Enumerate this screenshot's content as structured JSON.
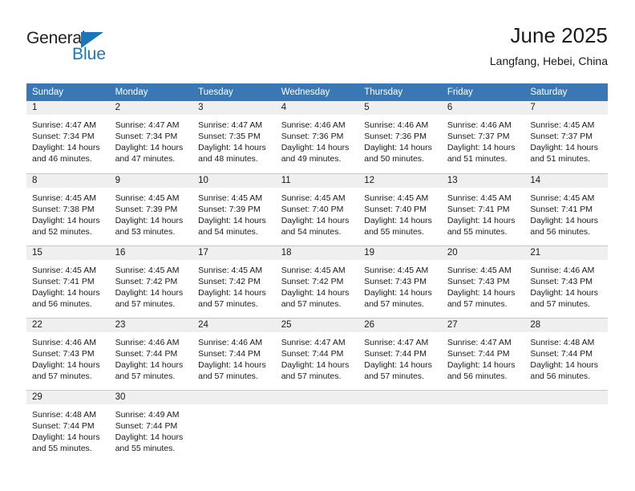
{
  "branding": {
    "logo_word_1": "General",
    "logo_word_2": "Blue",
    "triangle_color": "#1b75bb"
  },
  "header": {
    "title": "June 2025",
    "subtitle": "Langfang, Hebei, China",
    "header_bg_color": "#3a78b5",
    "daynum_band_color": "#efefef"
  },
  "weekday_headers": [
    "Sunday",
    "Monday",
    "Tuesday",
    "Wednesday",
    "Thursday",
    "Friday",
    "Saturday"
  ],
  "weeks": [
    [
      {
        "day": "1",
        "sunrise": "Sunrise: 4:47 AM",
        "sunset": "Sunset: 7:34 PM",
        "daylight_line1": "Daylight: 14 hours",
        "daylight_line2": "and 46 minutes."
      },
      {
        "day": "2",
        "sunrise": "Sunrise: 4:47 AM",
        "sunset": "Sunset: 7:34 PM",
        "daylight_line1": "Daylight: 14 hours",
        "daylight_line2": "and 47 minutes."
      },
      {
        "day": "3",
        "sunrise": "Sunrise: 4:47 AM",
        "sunset": "Sunset: 7:35 PM",
        "daylight_line1": "Daylight: 14 hours",
        "daylight_line2": "and 48 minutes."
      },
      {
        "day": "4",
        "sunrise": "Sunrise: 4:46 AM",
        "sunset": "Sunset: 7:36 PM",
        "daylight_line1": "Daylight: 14 hours",
        "daylight_line2": "and 49 minutes."
      },
      {
        "day": "5",
        "sunrise": "Sunrise: 4:46 AM",
        "sunset": "Sunset: 7:36 PM",
        "daylight_line1": "Daylight: 14 hours",
        "daylight_line2": "and 50 minutes."
      },
      {
        "day": "6",
        "sunrise": "Sunrise: 4:46 AM",
        "sunset": "Sunset: 7:37 PM",
        "daylight_line1": "Daylight: 14 hours",
        "daylight_line2": "and 51 minutes."
      },
      {
        "day": "7",
        "sunrise": "Sunrise: 4:45 AM",
        "sunset": "Sunset: 7:37 PM",
        "daylight_line1": "Daylight: 14 hours",
        "daylight_line2": "and 51 minutes."
      }
    ],
    [
      {
        "day": "8",
        "sunrise": "Sunrise: 4:45 AM",
        "sunset": "Sunset: 7:38 PM",
        "daylight_line1": "Daylight: 14 hours",
        "daylight_line2": "and 52 minutes."
      },
      {
        "day": "9",
        "sunrise": "Sunrise: 4:45 AM",
        "sunset": "Sunset: 7:39 PM",
        "daylight_line1": "Daylight: 14 hours",
        "daylight_line2": "and 53 minutes."
      },
      {
        "day": "10",
        "sunrise": "Sunrise: 4:45 AM",
        "sunset": "Sunset: 7:39 PM",
        "daylight_line1": "Daylight: 14 hours",
        "daylight_line2": "and 54 minutes."
      },
      {
        "day": "11",
        "sunrise": "Sunrise: 4:45 AM",
        "sunset": "Sunset: 7:40 PM",
        "daylight_line1": "Daylight: 14 hours",
        "daylight_line2": "and 54 minutes."
      },
      {
        "day": "12",
        "sunrise": "Sunrise: 4:45 AM",
        "sunset": "Sunset: 7:40 PM",
        "daylight_line1": "Daylight: 14 hours",
        "daylight_line2": "and 55 minutes."
      },
      {
        "day": "13",
        "sunrise": "Sunrise: 4:45 AM",
        "sunset": "Sunset: 7:41 PM",
        "daylight_line1": "Daylight: 14 hours",
        "daylight_line2": "and 55 minutes."
      },
      {
        "day": "14",
        "sunrise": "Sunrise: 4:45 AM",
        "sunset": "Sunset: 7:41 PM",
        "daylight_line1": "Daylight: 14 hours",
        "daylight_line2": "and 56 minutes."
      }
    ],
    [
      {
        "day": "15",
        "sunrise": "Sunrise: 4:45 AM",
        "sunset": "Sunset: 7:41 PM",
        "daylight_line1": "Daylight: 14 hours",
        "daylight_line2": "and 56 minutes."
      },
      {
        "day": "16",
        "sunrise": "Sunrise: 4:45 AM",
        "sunset": "Sunset: 7:42 PM",
        "daylight_line1": "Daylight: 14 hours",
        "daylight_line2": "and 57 minutes."
      },
      {
        "day": "17",
        "sunrise": "Sunrise: 4:45 AM",
        "sunset": "Sunset: 7:42 PM",
        "daylight_line1": "Daylight: 14 hours",
        "daylight_line2": "and 57 minutes."
      },
      {
        "day": "18",
        "sunrise": "Sunrise: 4:45 AM",
        "sunset": "Sunset: 7:42 PM",
        "daylight_line1": "Daylight: 14 hours",
        "daylight_line2": "and 57 minutes."
      },
      {
        "day": "19",
        "sunrise": "Sunrise: 4:45 AM",
        "sunset": "Sunset: 7:43 PM",
        "daylight_line1": "Daylight: 14 hours",
        "daylight_line2": "and 57 minutes."
      },
      {
        "day": "20",
        "sunrise": "Sunrise: 4:45 AM",
        "sunset": "Sunset: 7:43 PM",
        "daylight_line1": "Daylight: 14 hours",
        "daylight_line2": "and 57 minutes."
      },
      {
        "day": "21",
        "sunrise": "Sunrise: 4:46 AM",
        "sunset": "Sunset: 7:43 PM",
        "daylight_line1": "Daylight: 14 hours",
        "daylight_line2": "and 57 minutes."
      }
    ],
    [
      {
        "day": "22",
        "sunrise": "Sunrise: 4:46 AM",
        "sunset": "Sunset: 7:43 PM",
        "daylight_line1": "Daylight: 14 hours",
        "daylight_line2": "and 57 minutes."
      },
      {
        "day": "23",
        "sunrise": "Sunrise: 4:46 AM",
        "sunset": "Sunset: 7:44 PM",
        "daylight_line1": "Daylight: 14 hours",
        "daylight_line2": "and 57 minutes."
      },
      {
        "day": "24",
        "sunrise": "Sunrise: 4:46 AM",
        "sunset": "Sunset: 7:44 PM",
        "daylight_line1": "Daylight: 14 hours",
        "daylight_line2": "and 57 minutes."
      },
      {
        "day": "25",
        "sunrise": "Sunrise: 4:47 AM",
        "sunset": "Sunset: 7:44 PM",
        "daylight_line1": "Daylight: 14 hours",
        "daylight_line2": "and 57 minutes."
      },
      {
        "day": "26",
        "sunrise": "Sunrise: 4:47 AM",
        "sunset": "Sunset: 7:44 PM",
        "daylight_line1": "Daylight: 14 hours",
        "daylight_line2": "and 57 minutes."
      },
      {
        "day": "27",
        "sunrise": "Sunrise: 4:47 AM",
        "sunset": "Sunset: 7:44 PM",
        "daylight_line1": "Daylight: 14 hours",
        "daylight_line2": "and 56 minutes."
      },
      {
        "day": "28",
        "sunrise": "Sunrise: 4:48 AM",
        "sunset": "Sunset: 7:44 PM",
        "daylight_line1": "Daylight: 14 hours",
        "daylight_line2": "and 56 minutes."
      }
    ],
    [
      {
        "day": "29",
        "sunrise": "Sunrise: 4:48 AM",
        "sunset": "Sunset: 7:44 PM",
        "daylight_line1": "Daylight: 14 hours",
        "daylight_line2": "and 55 minutes."
      },
      {
        "day": "30",
        "sunrise": "Sunrise: 4:49 AM",
        "sunset": "Sunset: 7:44 PM",
        "daylight_line1": "Daylight: 14 hours",
        "daylight_line2": "and 55 minutes."
      },
      {
        "day": "",
        "sunrise": "",
        "sunset": "",
        "daylight_line1": "",
        "daylight_line2": ""
      },
      {
        "day": "",
        "sunrise": "",
        "sunset": "",
        "daylight_line1": "",
        "daylight_line2": ""
      },
      {
        "day": "",
        "sunrise": "",
        "sunset": "",
        "daylight_line1": "",
        "daylight_line2": ""
      },
      {
        "day": "",
        "sunrise": "",
        "sunset": "",
        "daylight_line1": "",
        "daylight_line2": ""
      },
      {
        "day": "",
        "sunrise": "",
        "sunset": "",
        "daylight_line1": "",
        "daylight_line2": ""
      }
    ]
  ]
}
